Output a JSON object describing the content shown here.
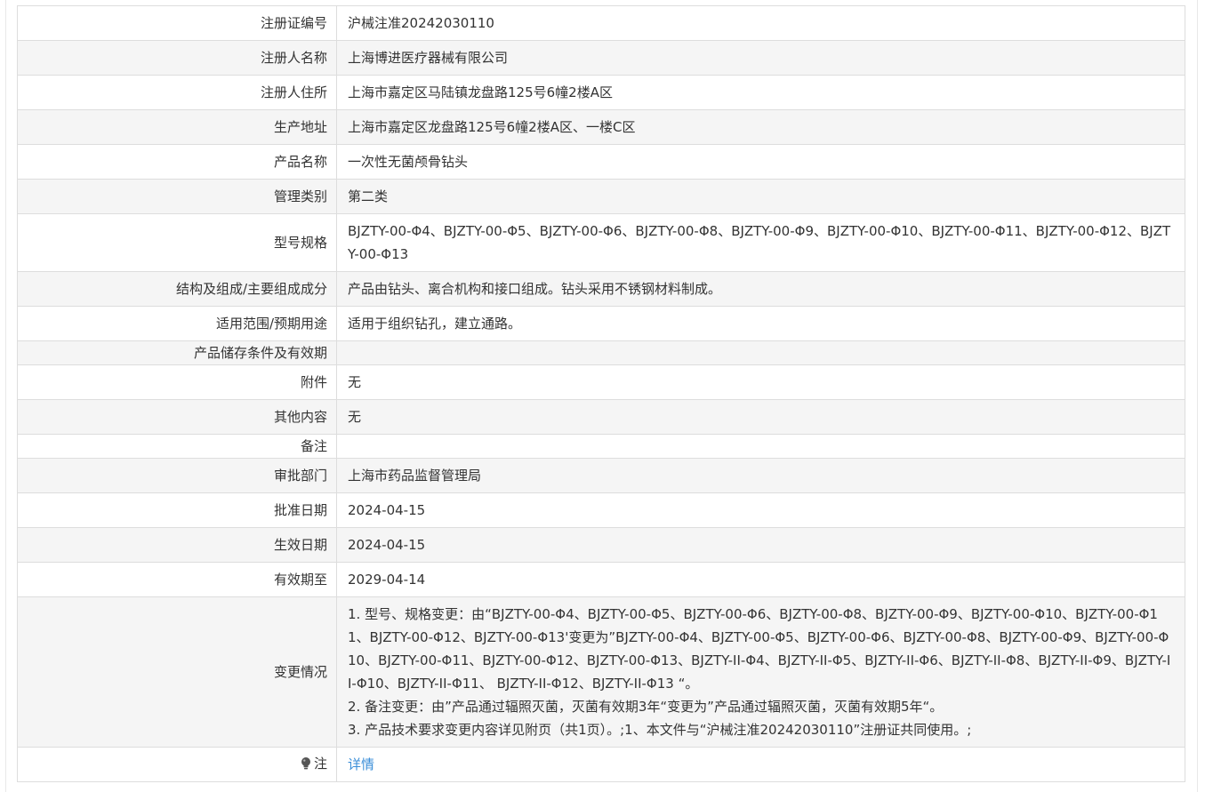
{
  "rows": [
    {
      "label": "注册证编号",
      "value": "沪械注准20242030110"
    },
    {
      "label": "注册人名称",
      "value": "上海博进医疗器械有限公司"
    },
    {
      "label": "注册人住所",
      "value": "上海市嘉定区马陆镇龙盘路125号6幢2楼A区"
    },
    {
      "label": "生产地址",
      "value": "上海市嘉定区龙盘路125号6幢2楼A区、一楼C区"
    },
    {
      "label": "产品名称",
      "value": "一次性无菌颅骨钻头"
    },
    {
      "label": "管理类别",
      "value": "第二类"
    },
    {
      "label": "型号规格",
      "value": "BJZTY-00-Φ4、BJZTY-00-Φ5、BJZTY-00-Φ6、BJZTY-00-Φ8、BJZTY-00-Φ9、BJZTY-00-Φ10、BJZTY-00-Φ11、BJZTY-00-Φ12、BJZTY-00-Φ13"
    },
    {
      "label": "结构及组成/主要组成成分",
      "value": "产品由钻头、离合机构和接口组成。钻头采用不锈钢材料制成。"
    },
    {
      "label": "适用范围/预期用途",
      "value": "适用于组织钻孔，建立通路。"
    },
    {
      "label": "产品储存条件及有效期",
      "value": ""
    },
    {
      "label": "附件",
      "value": "无"
    },
    {
      "label": "其他内容",
      "value": "无"
    },
    {
      "label": "备注",
      "value": ""
    },
    {
      "label": "审批部门",
      "value": "上海市药品监督管理局"
    },
    {
      "label": "批准日期",
      "value": "2024-04-15"
    },
    {
      "label": "生效日期",
      "value": "2024-04-15"
    },
    {
      "label": "有效期至",
      "value": "2029-04-14"
    }
  ],
  "changes": {
    "label": "变更情况",
    "lines": [
      "1. 型号、规格变更：由“BJZTY-00-Φ4、BJZTY-00-Φ5、BJZTY-00-Φ6、BJZTY-00-Φ8、BJZTY-00-Φ9、BJZTY-00-Φ10、BJZTY-00-Φ11、BJZTY-00-Φ12、BJZTY-00-Φ13'变更为”BJZTY-00-Φ4、BJZTY-00-Φ5、BJZTY-00-Φ6、BJZTY-00-Φ8、BJZTY-00-Φ9、BJZTY-00-Φ10、BJZTY-00-Φ11、BJZTY-00-Φ12、BJZTY-00-Φ13、BJZTY-II-Φ4、BJZTY-II-Φ5、BJZTY-II-Φ6、BJZTY-II-Φ8、BJZTY-II-Φ9、BJZTY-II-Φ10、BJZTY-II-Φ11、 BJZTY-II-Φ12、BJZTY-II-Φ13 “。",
      "2. 备注变更：由”产品通过辐照灭菌，灭菌有效期3年“变更为”产品通过辐照灭菌，灭菌有效期5年“。",
      "3. 产品技术要求变更内容详见附页（共1页）。;1、本文件与“沪械注准20242030110”注册证共同使用。;"
    ]
  },
  "note": {
    "label": "注",
    "icon": "lightbulb-icon",
    "link_text": "详情",
    "link_color": "#3a8ed8"
  }
}
